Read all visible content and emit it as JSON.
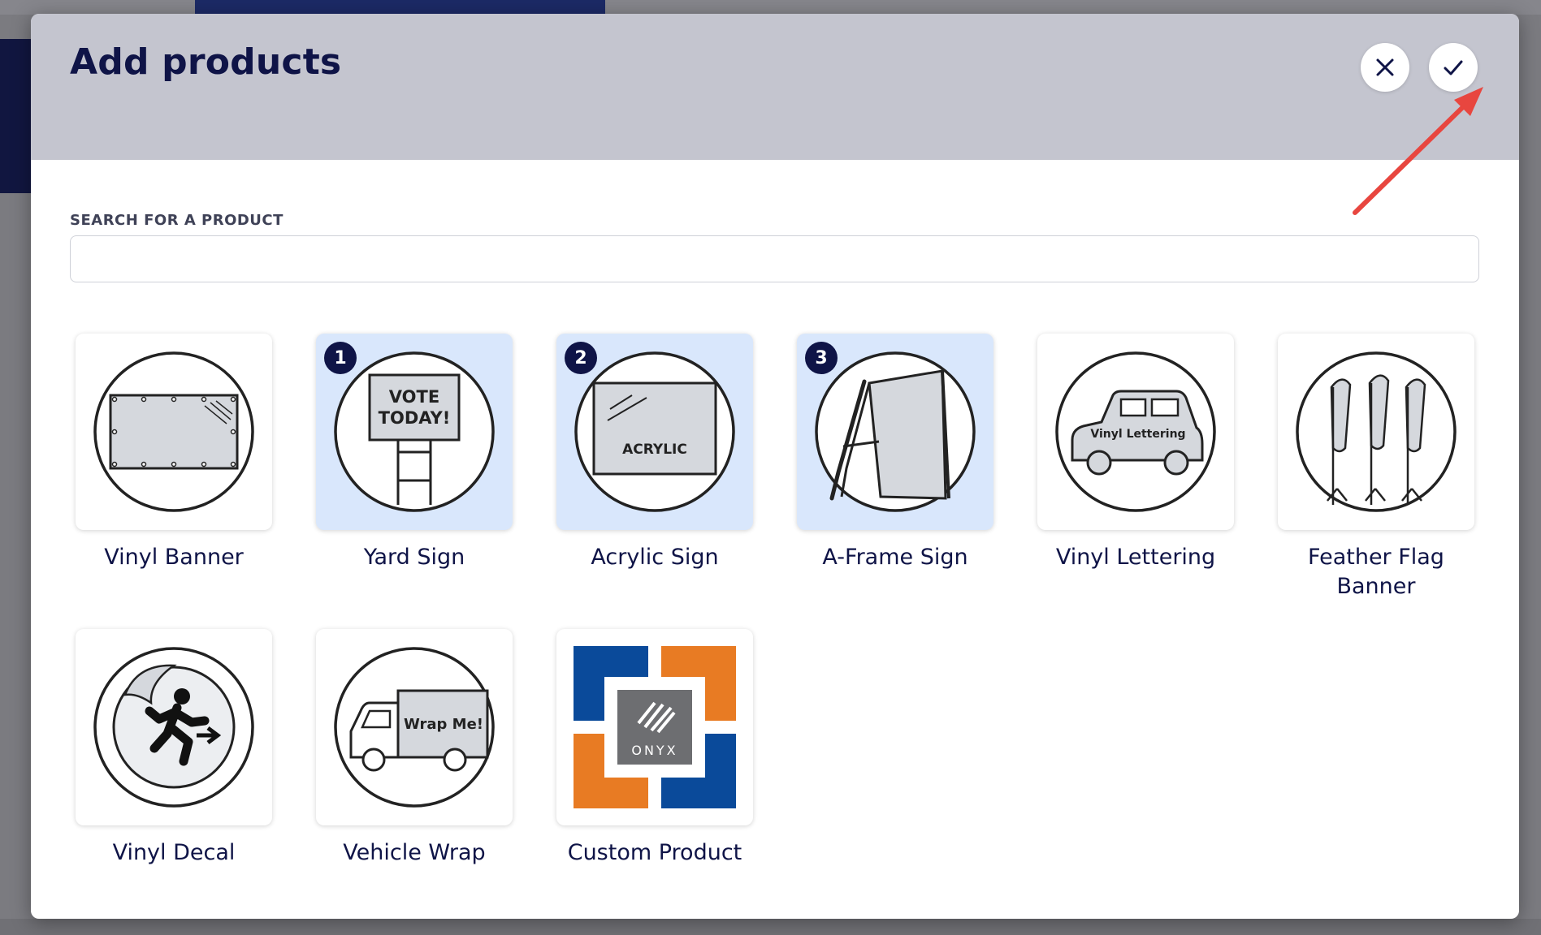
{
  "modal": {
    "title": "Add products",
    "close_icon": "close-icon",
    "confirm_icon": "check-icon"
  },
  "search": {
    "label": "SEARCH FOR A PRODUCT",
    "value": "",
    "placeholder": ""
  },
  "products": [
    {
      "label": "Vinyl Banner",
      "icon": "vinyl-banner-icon",
      "selected": false,
      "order": ""
    },
    {
      "label": "Yard Sign",
      "icon": "yard-sign-icon",
      "selected": true,
      "order": "1",
      "sign_text_line1": "VOTE",
      "sign_text_line2": "TODAY!"
    },
    {
      "label": "Acrylic Sign",
      "icon": "acrylic-sign-icon",
      "selected": true,
      "order": "2",
      "sign_text": "ACRYLIC"
    },
    {
      "label": "A-Frame Sign",
      "icon": "a-frame-sign-icon",
      "selected": true,
      "order": "3"
    },
    {
      "label": "Vinyl Lettering",
      "icon": "vinyl-lettering-icon",
      "selected": false,
      "order": "",
      "sign_text": "Vinyl Lettering"
    },
    {
      "label": "Feather Flag Banner",
      "icon": "feather-flag-icon",
      "selected": false,
      "order": ""
    },
    {
      "label": "Vinyl Decal",
      "icon": "vinyl-decal-icon",
      "selected": false,
      "order": ""
    },
    {
      "label": "Vehicle Wrap",
      "icon": "vehicle-wrap-icon",
      "selected": false,
      "order": "",
      "sign_text": "Wrap Me!"
    },
    {
      "label": "Custom Product",
      "icon": "onyx-logo-icon",
      "selected": false,
      "order": "",
      "logo_text": "ONYX"
    }
  ],
  "colors": {
    "header_bg": "#c4c5cf",
    "title": "#0f1447",
    "selected_card": "#d9e7fc",
    "badge": "#0f1447",
    "annotation_arrow": "#e8463f",
    "onyx_blue": "#0a4a9a",
    "onyx_orange": "#e87b23",
    "onyx_gray": "#6d6e71"
  }
}
